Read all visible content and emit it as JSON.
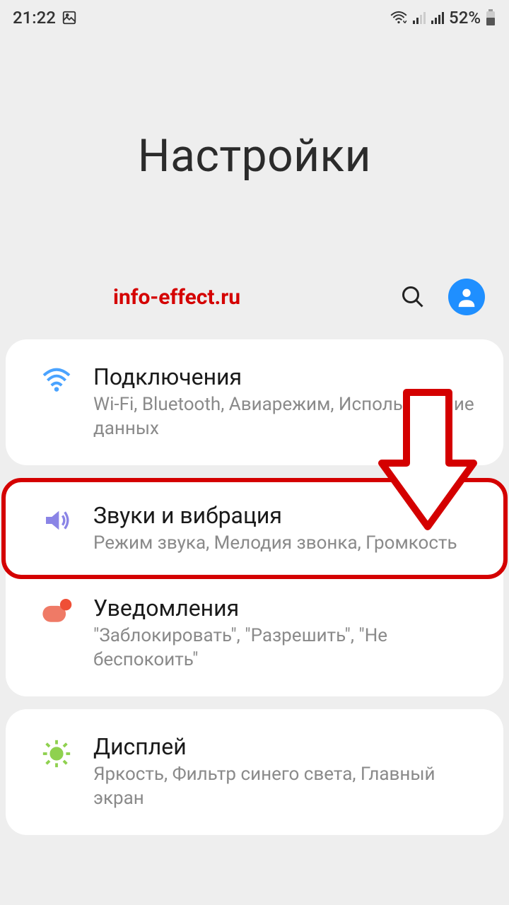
{
  "status": {
    "time": "21:22",
    "battery_pct": "52%"
  },
  "hero": {
    "title": "Настройки"
  },
  "watermark": "info-effect.ru",
  "cards": [
    {
      "items": [
        {
          "title": "Подключения",
          "sub": "Wi-Fi, Bluetooth, Авиарежим, Использование данных"
        }
      ]
    },
    {
      "items": [
        {
          "title": "Звуки и вибрация",
          "sub": "Режим звука, Мелодия звонка, Громкость"
        },
        {
          "title": "Уведомления",
          "sub": "\"Заблокировать\", \"Разрешить\", \"Не беспокоить\""
        }
      ]
    },
    {
      "items": [
        {
          "title": "Дисплей",
          "sub": "Яркость, Фильтр синего света, Главный экран"
        }
      ]
    }
  ]
}
